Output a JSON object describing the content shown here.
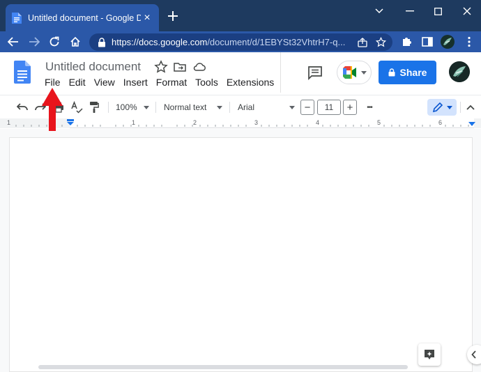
{
  "browser": {
    "tab_title": "Untitled document - Google Docs",
    "tab_close": "×",
    "url_host": "https://docs.google.com",
    "url_path": "/document/d/1EBYSt32VhtrH7-q..."
  },
  "doc": {
    "title": "Untitled document",
    "menu": [
      "File",
      "Edit",
      "View",
      "Insert",
      "Format",
      "Tools",
      "Extensions"
    ],
    "share_label": "Share"
  },
  "toolbar": {
    "zoom": "100%",
    "style": "Normal text",
    "font": "Arial",
    "size_minus": "−",
    "font_size": "11",
    "size_plus": "+",
    "more": "•••"
  },
  "ruler": {
    "labels": [
      "1",
      "1",
      "2",
      "3",
      "4",
      "5",
      "6"
    ]
  },
  "colors": {
    "accent": "#1a73e8",
    "tab_active": "#2b58a8",
    "tab_strip": "#1e3a5f",
    "annotation": "#e8141c"
  },
  "icons": {
    "docs_logo": "google-docs-icon",
    "comments": "comments-icon",
    "meet": "google-meet-icon",
    "lock": "lock-icon",
    "explore": "explore-icon"
  }
}
